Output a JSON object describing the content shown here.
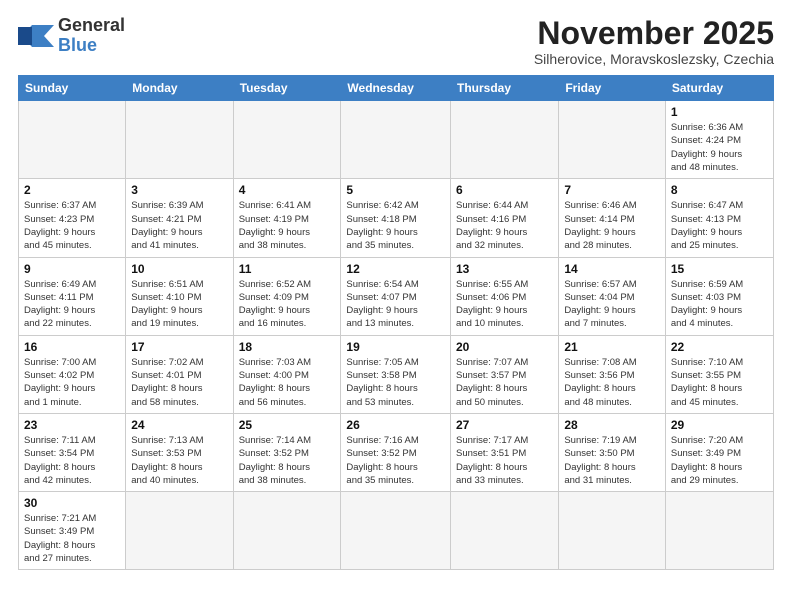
{
  "header": {
    "logo_general": "General",
    "logo_blue": "Blue",
    "month_title": "November 2025",
    "subtitle": "Silherovice, Moravskoslezsky, Czechia"
  },
  "days_of_week": [
    "Sunday",
    "Monday",
    "Tuesday",
    "Wednesday",
    "Thursday",
    "Friday",
    "Saturday"
  ],
  "weeks": [
    [
      {
        "num": "",
        "info": ""
      },
      {
        "num": "",
        "info": ""
      },
      {
        "num": "",
        "info": ""
      },
      {
        "num": "",
        "info": ""
      },
      {
        "num": "",
        "info": ""
      },
      {
        "num": "",
        "info": ""
      },
      {
        "num": "1",
        "info": "Sunrise: 6:36 AM\nSunset: 4:24 PM\nDaylight: 9 hours\nand 48 minutes."
      }
    ],
    [
      {
        "num": "2",
        "info": "Sunrise: 6:37 AM\nSunset: 4:23 PM\nDaylight: 9 hours\nand 45 minutes."
      },
      {
        "num": "3",
        "info": "Sunrise: 6:39 AM\nSunset: 4:21 PM\nDaylight: 9 hours\nand 41 minutes."
      },
      {
        "num": "4",
        "info": "Sunrise: 6:41 AM\nSunset: 4:19 PM\nDaylight: 9 hours\nand 38 minutes."
      },
      {
        "num": "5",
        "info": "Sunrise: 6:42 AM\nSunset: 4:18 PM\nDaylight: 9 hours\nand 35 minutes."
      },
      {
        "num": "6",
        "info": "Sunrise: 6:44 AM\nSunset: 4:16 PM\nDaylight: 9 hours\nand 32 minutes."
      },
      {
        "num": "7",
        "info": "Sunrise: 6:46 AM\nSunset: 4:14 PM\nDaylight: 9 hours\nand 28 minutes."
      },
      {
        "num": "8",
        "info": "Sunrise: 6:47 AM\nSunset: 4:13 PM\nDaylight: 9 hours\nand 25 minutes."
      }
    ],
    [
      {
        "num": "9",
        "info": "Sunrise: 6:49 AM\nSunset: 4:11 PM\nDaylight: 9 hours\nand 22 minutes."
      },
      {
        "num": "10",
        "info": "Sunrise: 6:51 AM\nSunset: 4:10 PM\nDaylight: 9 hours\nand 19 minutes."
      },
      {
        "num": "11",
        "info": "Sunrise: 6:52 AM\nSunset: 4:09 PM\nDaylight: 9 hours\nand 16 minutes."
      },
      {
        "num": "12",
        "info": "Sunrise: 6:54 AM\nSunset: 4:07 PM\nDaylight: 9 hours\nand 13 minutes."
      },
      {
        "num": "13",
        "info": "Sunrise: 6:55 AM\nSunset: 4:06 PM\nDaylight: 9 hours\nand 10 minutes."
      },
      {
        "num": "14",
        "info": "Sunrise: 6:57 AM\nSunset: 4:04 PM\nDaylight: 9 hours\nand 7 minutes."
      },
      {
        "num": "15",
        "info": "Sunrise: 6:59 AM\nSunset: 4:03 PM\nDaylight: 9 hours\nand 4 minutes."
      }
    ],
    [
      {
        "num": "16",
        "info": "Sunrise: 7:00 AM\nSunset: 4:02 PM\nDaylight: 9 hours\nand 1 minute."
      },
      {
        "num": "17",
        "info": "Sunrise: 7:02 AM\nSunset: 4:01 PM\nDaylight: 8 hours\nand 58 minutes."
      },
      {
        "num": "18",
        "info": "Sunrise: 7:03 AM\nSunset: 4:00 PM\nDaylight: 8 hours\nand 56 minutes."
      },
      {
        "num": "19",
        "info": "Sunrise: 7:05 AM\nSunset: 3:58 PM\nDaylight: 8 hours\nand 53 minutes."
      },
      {
        "num": "20",
        "info": "Sunrise: 7:07 AM\nSunset: 3:57 PM\nDaylight: 8 hours\nand 50 minutes."
      },
      {
        "num": "21",
        "info": "Sunrise: 7:08 AM\nSunset: 3:56 PM\nDaylight: 8 hours\nand 48 minutes."
      },
      {
        "num": "22",
        "info": "Sunrise: 7:10 AM\nSunset: 3:55 PM\nDaylight: 8 hours\nand 45 minutes."
      }
    ],
    [
      {
        "num": "23",
        "info": "Sunrise: 7:11 AM\nSunset: 3:54 PM\nDaylight: 8 hours\nand 42 minutes."
      },
      {
        "num": "24",
        "info": "Sunrise: 7:13 AM\nSunset: 3:53 PM\nDaylight: 8 hours\nand 40 minutes."
      },
      {
        "num": "25",
        "info": "Sunrise: 7:14 AM\nSunset: 3:52 PM\nDaylight: 8 hours\nand 38 minutes."
      },
      {
        "num": "26",
        "info": "Sunrise: 7:16 AM\nSunset: 3:52 PM\nDaylight: 8 hours\nand 35 minutes."
      },
      {
        "num": "27",
        "info": "Sunrise: 7:17 AM\nSunset: 3:51 PM\nDaylight: 8 hours\nand 33 minutes."
      },
      {
        "num": "28",
        "info": "Sunrise: 7:19 AM\nSunset: 3:50 PM\nDaylight: 8 hours\nand 31 minutes."
      },
      {
        "num": "29",
        "info": "Sunrise: 7:20 AM\nSunset: 3:49 PM\nDaylight: 8 hours\nand 29 minutes."
      }
    ],
    [
      {
        "num": "30",
        "info": "Sunrise: 7:21 AM\nSunset: 3:49 PM\nDaylight: 8 hours\nand 27 minutes."
      },
      {
        "num": "",
        "info": ""
      },
      {
        "num": "",
        "info": ""
      },
      {
        "num": "",
        "info": ""
      },
      {
        "num": "",
        "info": ""
      },
      {
        "num": "",
        "info": ""
      },
      {
        "num": "",
        "info": ""
      }
    ]
  ]
}
